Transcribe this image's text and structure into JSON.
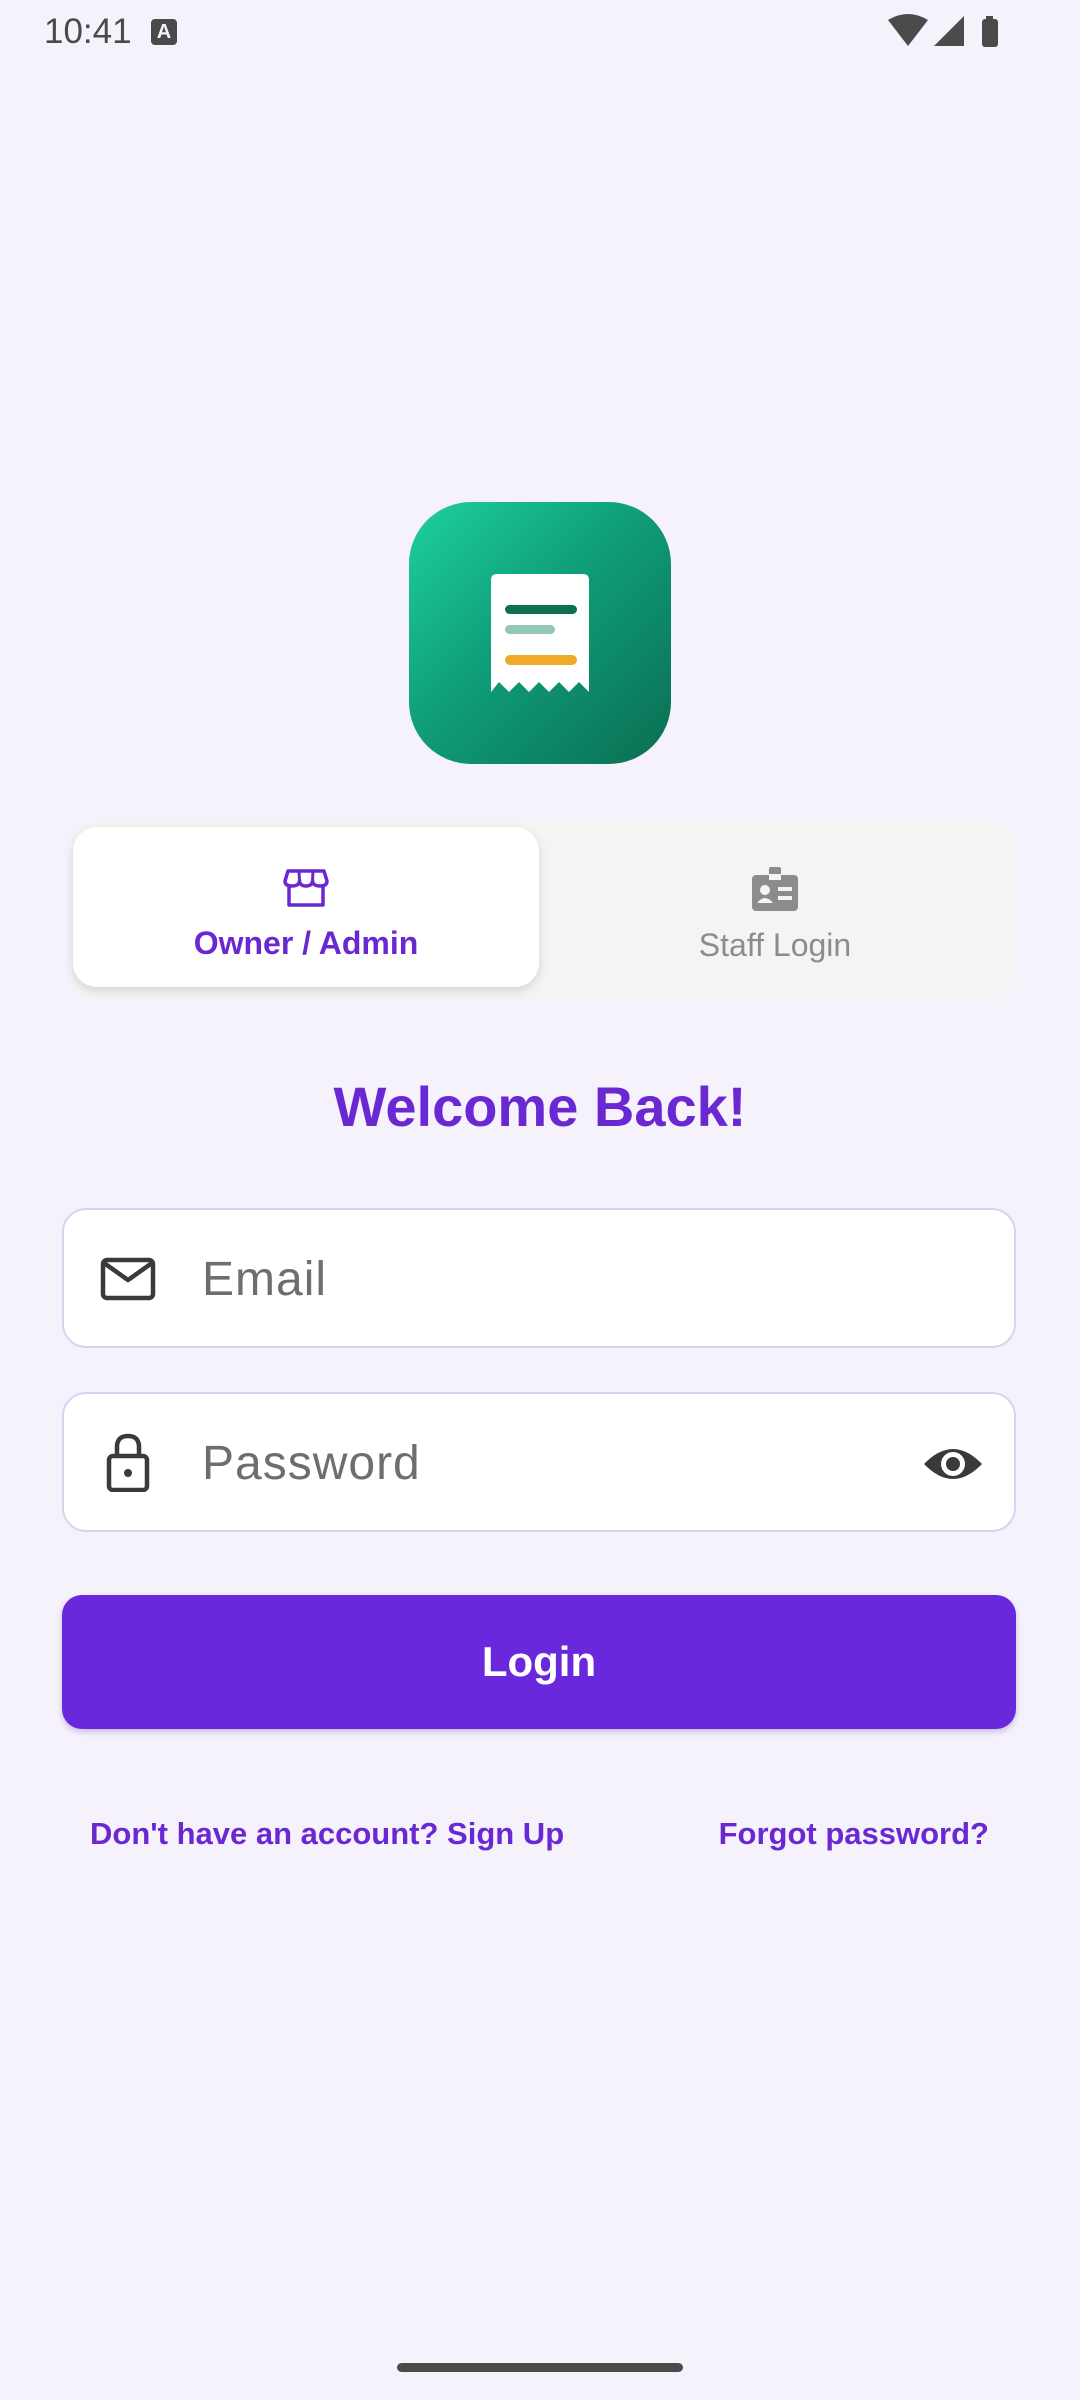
{
  "status_bar": {
    "time": "10:41",
    "notification_icon_letter": "A",
    "icons": [
      "wifi-icon",
      "cellular-signal-icon",
      "battery-icon"
    ]
  },
  "logo": {
    "icon": "receipt-icon",
    "gradient_colors": [
      "#1FD09F",
      "#0B6E52"
    ],
    "receipt_line_colors": [
      "#0E6F53",
      "#93C8B8",
      "#F0A928"
    ]
  },
  "tabs": [
    {
      "label": "Owner / Admin",
      "icon": "storefront-icon",
      "active": true
    },
    {
      "label": "Staff Login",
      "icon": "id-badge-icon",
      "active": false
    }
  ],
  "title": "Welcome Back!",
  "form": {
    "email": {
      "placeholder": "Email",
      "value": "",
      "icon": "mail-icon"
    },
    "password": {
      "placeholder": "Password",
      "value": "",
      "icon": "lock-icon",
      "toggle_icon": "eye-icon"
    },
    "login_label": "Login"
  },
  "links": {
    "signup": "Don't have an account? Sign Up",
    "forgot": "Forgot password?"
  },
  "colors": {
    "accent": "#6A28D2",
    "button": "#6A28DC",
    "background": "#F5F2FC"
  }
}
